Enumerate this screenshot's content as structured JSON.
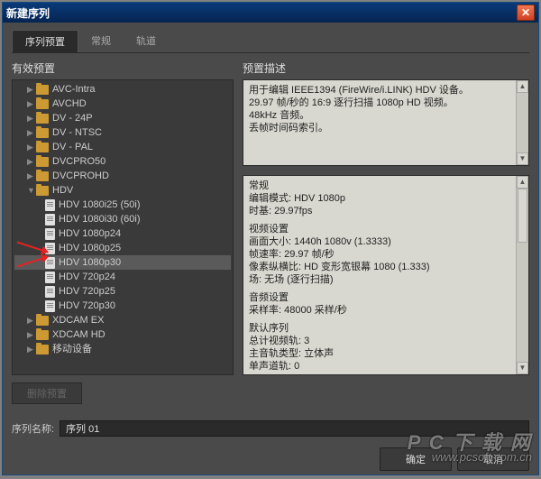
{
  "window": {
    "title": "新建序列"
  },
  "tabs": {
    "t1": "序列预置",
    "t2": "常规",
    "t3": "轨道"
  },
  "panel": {
    "leftTitle": "有效预置",
    "rightTitle": "预置描述"
  },
  "tree": {
    "folders": {
      "f0": "AVC-Intra",
      "f1": "AVCHD",
      "f2": "DV - 24P",
      "f3": "DV - NTSC",
      "f4": "DV - PAL",
      "f5": "DVCPRO50",
      "f6": "DVCPROHD",
      "f7": "HDV",
      "f8": "XDCAM EX",
      "f9": "XDCAM HD",
      "f10": "移动设备"
    },
    "hdv": {
      "i0": "HDV 1080i25 (50i)",
      "i1": "HDV 1080i30 (60i)",
      "i2": "HDV 1080p24",
      "i3": "HDV 1080p25",
      "i4": "HDV 1080p30",
      "i5": "HDV 720p24",
      "i6": "HDV 720p25",
      "i7": "HDV 720p30"
    }
  },
  "desc": {
    "l1": "用于编辑 IEEE1394 (FireWire/i.LINK) HDV 设备。",
    "l2": "29.97 帧/秒的 16:9 逐行扫描 1080p HD 视频。",
    "l3": "48kHz 音频。",
    "l4": "丢帧时间码索引。"
  },
  "props": {
    "general_h": "常规",
    "edit_mode": "编辑模式: HDV 1080p",
    "timebase": "时基: 29.97fps",
    "video_h": "视频设置",
    "frame_size": "画面大小: 1440h 1080v (1.3333)",
    "frame_rate": "帧速率: 29.97 帧/秒",
    "pixel_ar": "像素纵横比: HD 变形宽银幕 1080 (1.333)",
    "fields": "场: 无场 (逐行扫描)",
    "audio_h": "音频设置",
    "sample_rate": "采样率: 48000 采样/秒",
    "default_h": "默认序列",
    "video_tracks": "总计视频轨: 3",
    "master_type": "主音轨类型: 立体声",
    "mono_tracks": "单声道轨: 0"
  },
  "buttons": {
    "delete": "删除预置",
    "ok": "确定",
    "cancel": "取消"
  },
  "seq": {
    "label": "序列名称:",
    "value": "序列 01"
  },
  "watermark": {
    "big": "P C 下 载 网",
    "url": "www.pcsoft.com.cn"
  }
}
